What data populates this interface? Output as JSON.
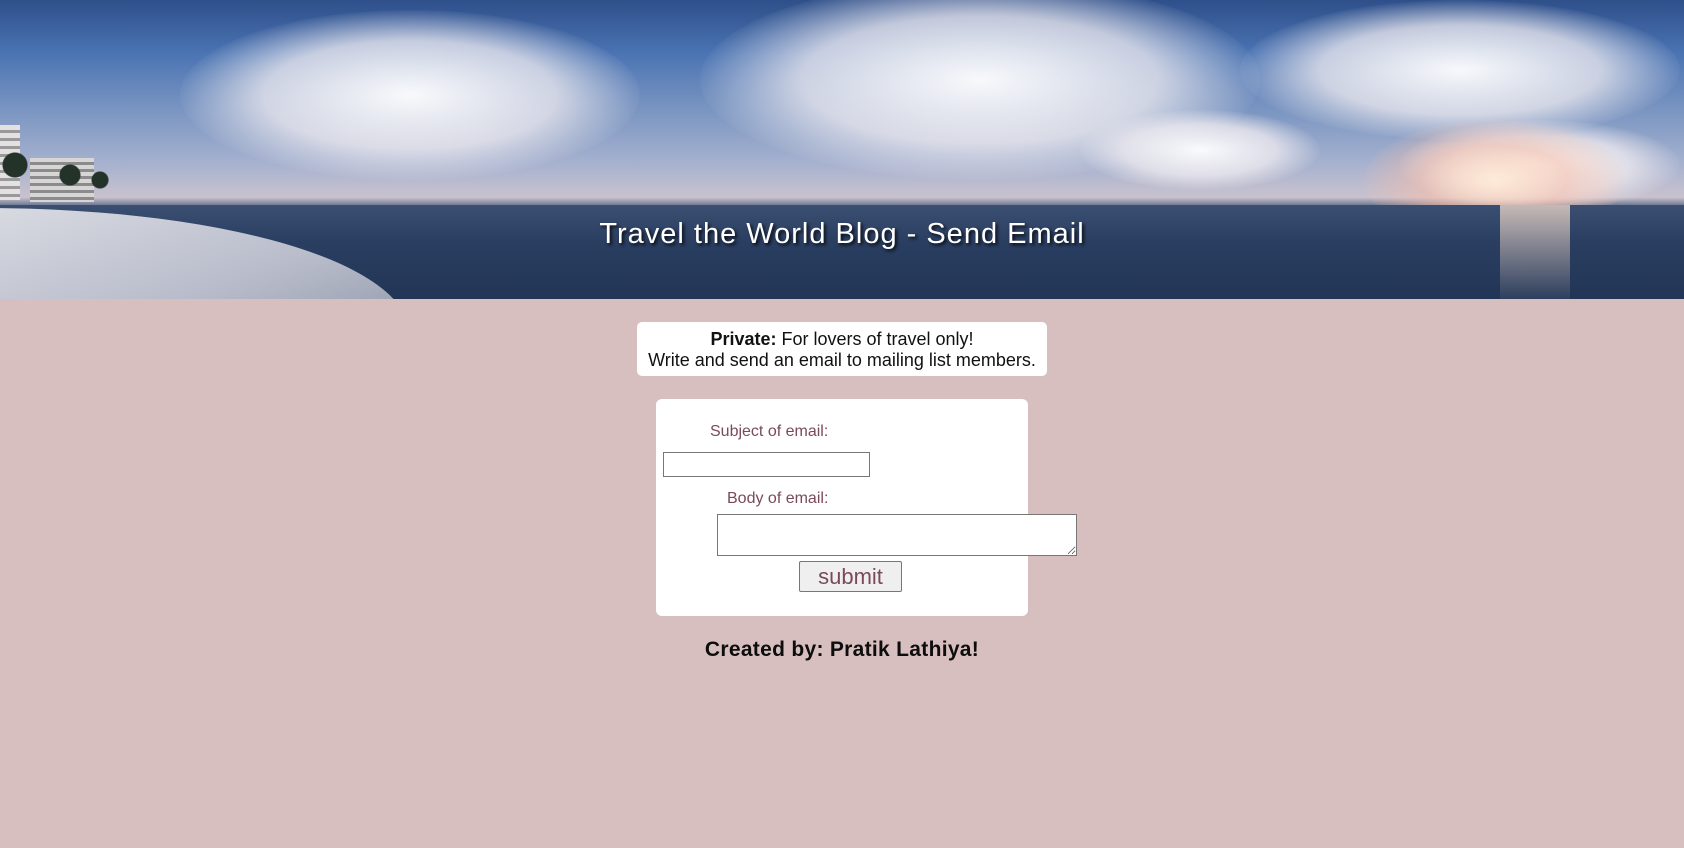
{
  "header": {
    "title": "Travel the World Blog - Send Email"
  },
  "notice": {
    "bold_label": "Private:",
    "line1_rest": " For lovers of travel only!",
    "line2": "Write and send an email to mailing list members."
  },
  "form": {
    "subject_label": "Subject of email:",
    "subject_value": "",
    "body_label": "Body of email:",
    "body_value": "",
    "submit_label": "submit"
  },
  "footer": {
    "text": "Created by: Pratik Lathiya!"
  },
  "colors": {
    "page_background": "#d8bfbf",
    "label_color": "#7a4a5a",
    "card_background": "#ffffff"
  }
}
